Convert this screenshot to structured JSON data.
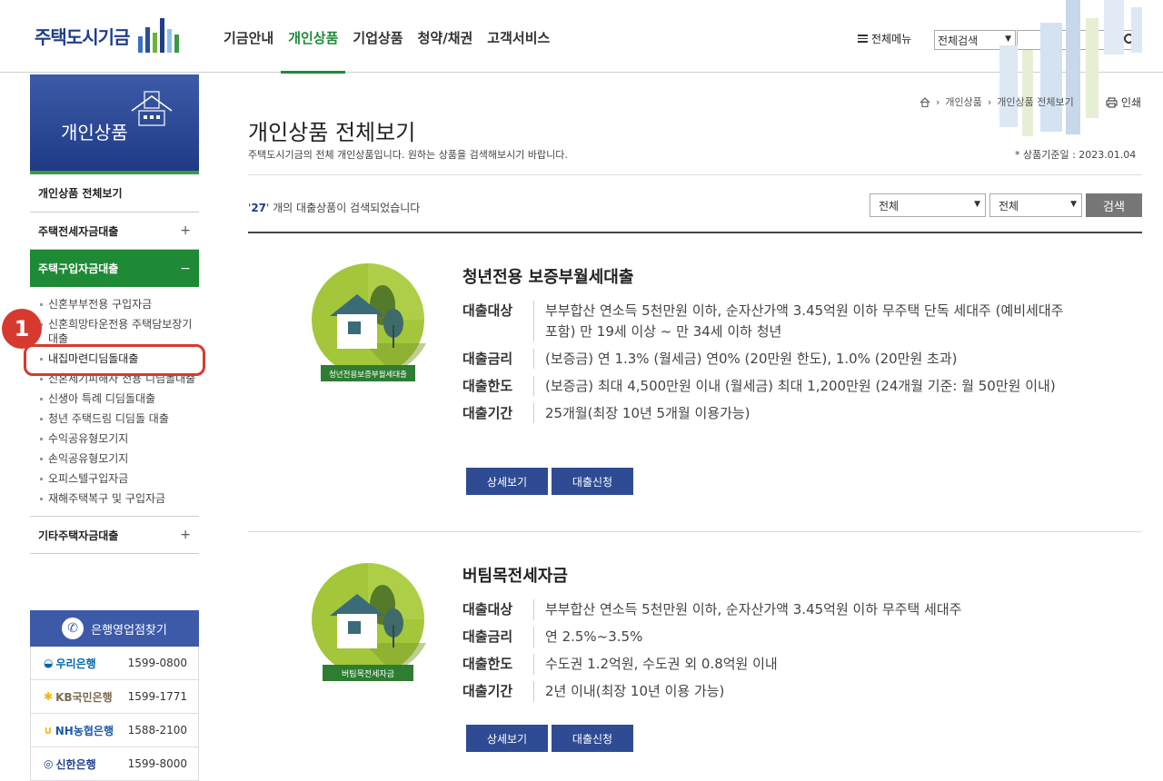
{
  "header": {
    "logo_text": "주택도시기금",
    "nav": [
      "기금안내",
      "개인상품",
      "기업상품",
      "청약/채권",
      "고객서비스"
    ],
    "all_menu": "전체메뉴",
    "search_scope": "전체검색"
  },
  "sidebar": {
    "visual_title": "개인상품",
    "items": [
      {
        "label": "개인상품 전체보기",
        "toggle": ""
      },
      {
        "label": "주택전세자금대출",
        "toggle": "+"
      },
      {
        "label": "주택구입자금대출",
        "toggle": "−"
      }
    ],
    "sub_items": [
      "신혼부부전용 구입자금",
      "신혼희망타운전용 주택담보장기대출",
      "내집마련디딤돌대출",
      "신혼세기피해자 전용 디딤돌대출",
      "신생아 특례 디딤돌대출",
      "청년 주택드림 디딤돌 대출",
      "수익공유형모기지",
      "손익공유형모기지",
      "오피스텔구입자금",
      "재해주택복구 및 구입자금"
    ],
    "last_item": {
      "label": "기타주택자금대출",
      "toggle": "+"
    },
    "annotation_number": "1"
  },
  "bank_finder": {
    "title": "은행영업점찾기",
    "banks": [
      {
        "name": "우리은행",
        "phone": "1599-0800",
        "color": "#0067ac"
      },
      {
        "name": "KB국민은행",
        "phone": "1599-1771",
        "color": "#7d6a4f"
      },
      {
        "name": "NH농협은행",
        "phone": "1588-2100",
        "color": "#1d5aa8"
      },
      {
        "name": "신한은행",
        "phone": "1599-8000",
        "color": "#1f3f8a"
      }
    ]
  },
  "breadcrumb": [
    "개인상품",
    "개인상품 전체보기"
  ],
  "print_label": "인쇄",
  "page": {
    "title": "개인상품 전체보기",
    "description": "주택도시기금의 전체 개인상품입니다. 원하는 상품을 검색해보시기 바랍니다.",
    "base_date": "* 상품기준일 : 2023.01.04",
    "result_count": "27",
    "result_text": "개의 대출상품이 검색되었습니다",
    "filter1": "전체",
    "filter2": "전체",
    "search_button": "검색"
  },
  "products": [
    {
      "badge_text": "청년전용보증부월세대출",
      "name": "청년전용 보증부월세대출",
      "rows": [
        {
          "k": "대출대상",
          "v": "부부합산 연소득 5천만원 이하, 순자산가액 3.45억원 이하 무주택 단독 세대주 (예비세대주 포함) 만 19세 이상 ~ 만 34세 이하 청년"
        },
        {
          "k": "대출금리",
          "v": "(보증금) 연 1.3% (월세금) 연0% (20만원 한도),  1.0% (20만원 초과)"
        },
        {
          "k": "대출한도",
          "v": "(보증금) 최대 4,500만원 이내 (월세금) 최대 1,200만원 (24개월 기준: 월 50만원 이내)"
        },
        {
          "k": "대출기간",
          "v": "25개월(최장 10년 5개월 이용가능)"
        }
      ],
      "detail_button": "상세보기",
      "apply_button": "대출신청"
    },
    {
      "badge_text": "버팀목전세자금",
      "name": "버팀목전세자금",
      "rows": [
        {
          "k": "대출대상",
          "v": "부부합산 연소득 5천만원 이하, 순자산가액 3.45억원 이하 무주택 세대주"
        },
        {
          "k": "대출금리",
          "v": "연 2.5%~3.5%"
        },
        {
          "k": "대출한도",
          "v": "수도권 1.2억원, 수도권 외 0.8억원 이내"
        },
        {
          "k": "대출기간",
          "v": "2년 이내(최장 10년 이용 가능)"
        }
      ],
      "detail_button": "상세보기",
      "apply_button": "대출신청"
    }
  ]
}
